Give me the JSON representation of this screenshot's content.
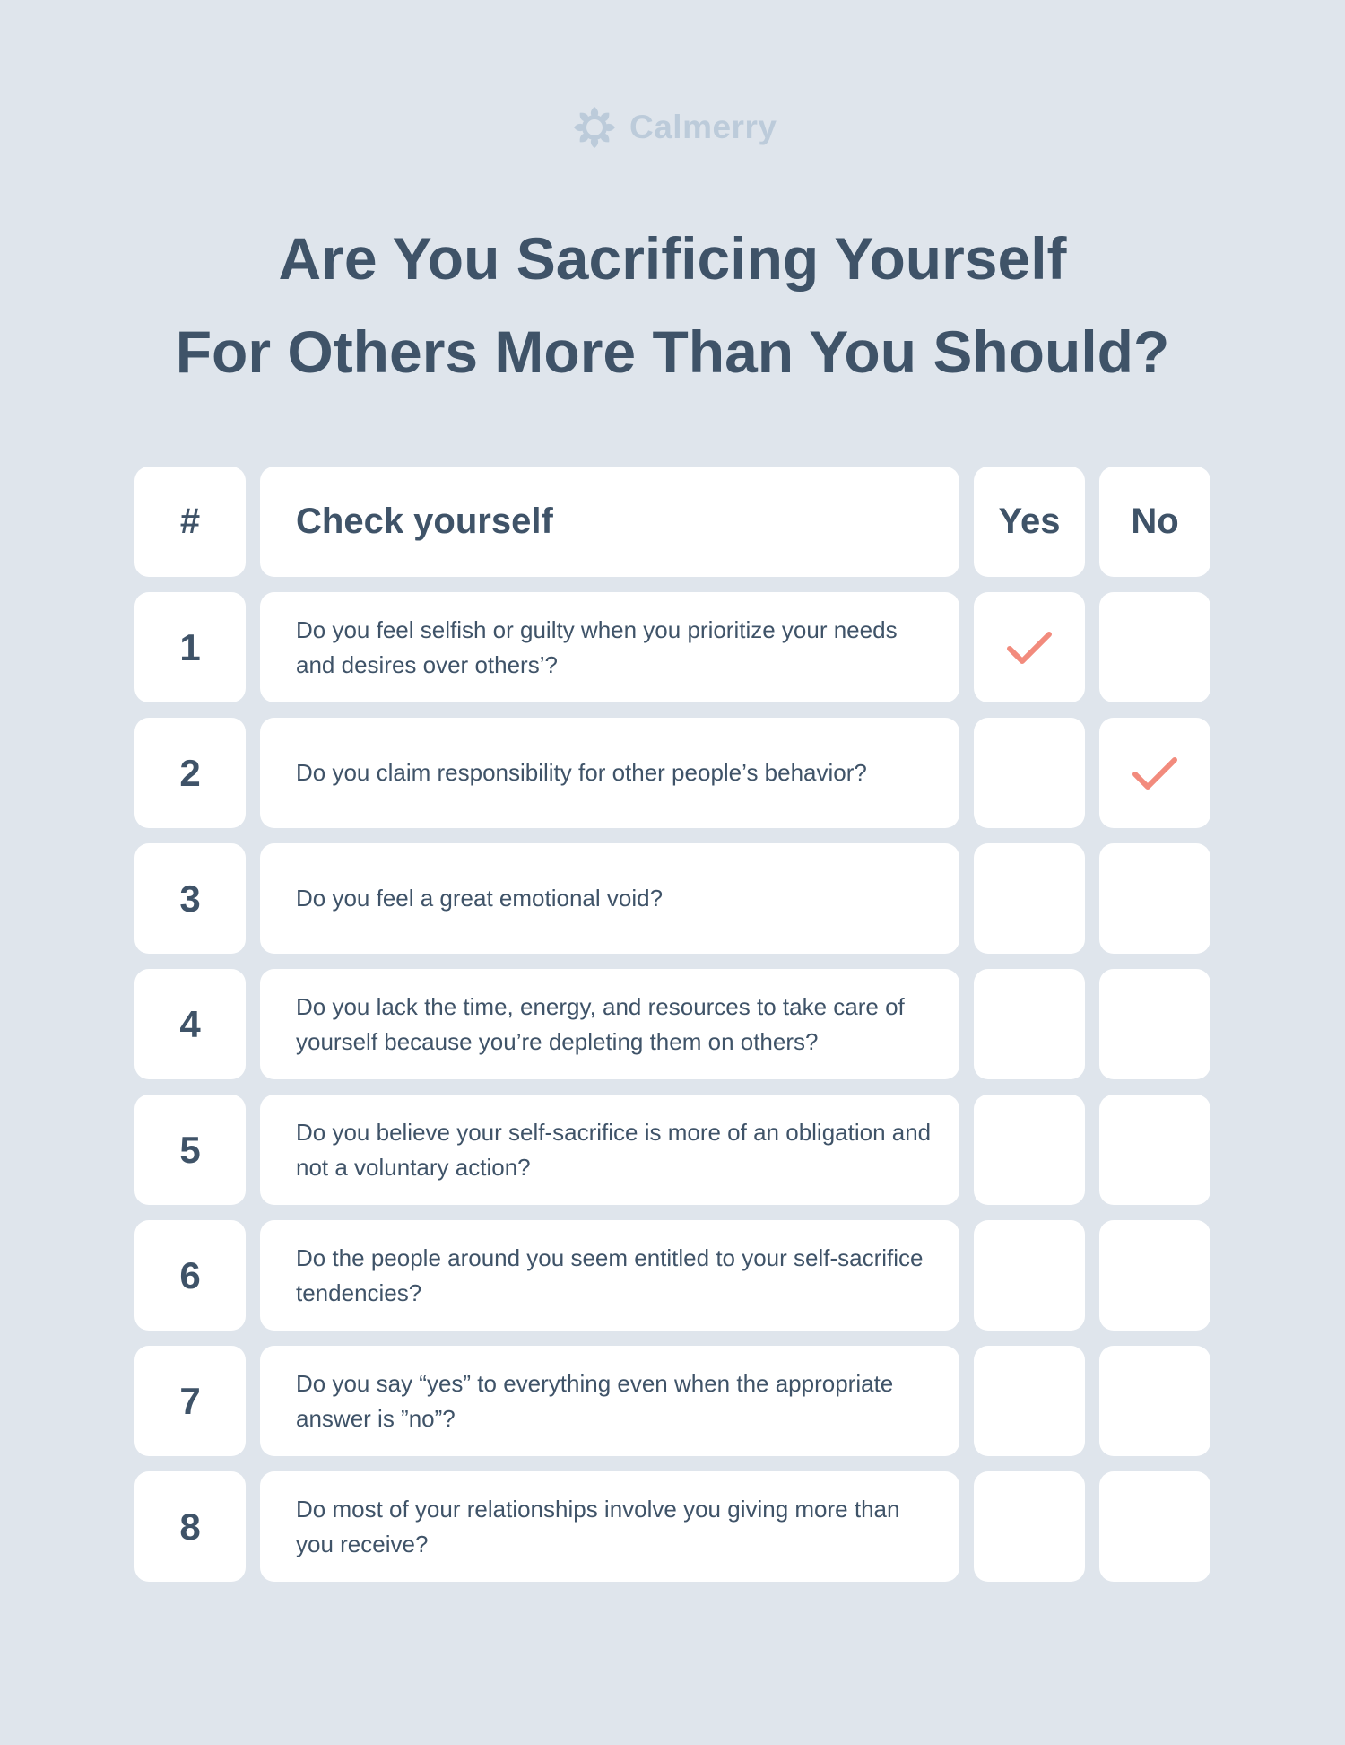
{
  "brand": {
    "logo_icon": "flower-icon",
    "name": "Calmerry",
    "logo_color": "#bccbda"
  },
  "title": {
    "line1": "Are You Sacrificing Yourself",
    "line2": "For Others More Than You Should?"
  },
  "table": {
    "headers": {
      "number": "#",
      "question": "Check yourself",
      "yes": "Yes",
      "no": "No"
    },
    "check_icon": "checkmark-icon",
    "check_color": "#f28b7d",
    "rows": [
      {
        "number": "1",
        "question": "Do you feel selfish or guilty when you prioritize your needs and desires over others’?",
        "answer": "yes"
      },
      {
        "number": "2",
        "question": "Do you claim responsibility for other people’s behavior?",
        "answer": "no"
      },
      {
        "number": "3",
        "question": "Do you feel a great emotional void?",
        "answer": ""
      },
      {
        "number": "4",
        "question": "Do you lack the time, energy, and resources to take care of yourself because you’re depleting them on others?",
        "answer": ""
      },
      {
        "number": "5",
        "question": "Do you believe your self-sacrifice is more of an obligation and not a voluntary action?",
        "answer": ""
      },
      {
        "number": "6",
        "question": "Do the people around you seem entitled to your self-sacrifice tendencies?",
        "answer": ""
      },
      {
        "number": "7",
        "question": "Do you say “yes” to everything even when the appropriate answer is ”no”?",
        "answer": ""
      },
      {
        "number": "8",
        "question": "Do most of your relationships involve you giving more than you receive?",
        "answer": ""
      }
    ]
  },
  "colors": {
    "background": "#dfe5ec",
    "text": "#3f5368",
    "cell": "#ffffff"
  }
}
